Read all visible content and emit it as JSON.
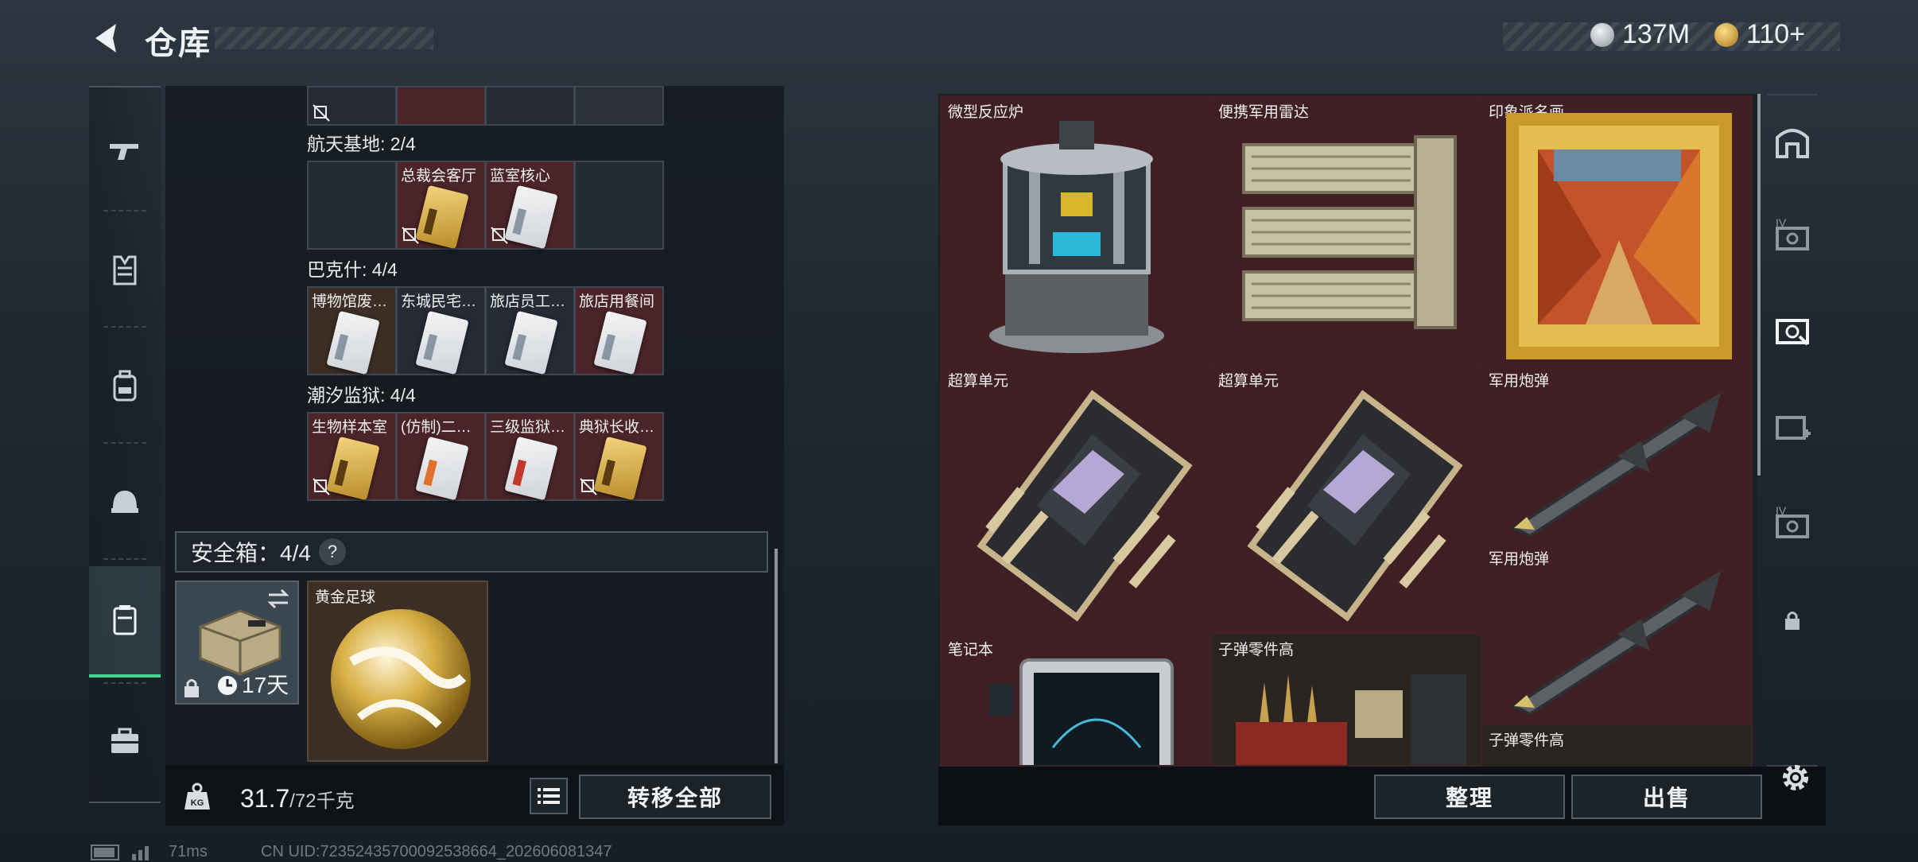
{
  "header": {
    "title": "仓库",
    "currency": [
      {
        "icon": "silver-coin-icon",
        "value": "137M",
        "color": "#c9ced3"
      },
      {
        "icon": "gold-coin-icon",
        "value": "110+",
        "color": "#d9a93a"
      }
    ]
  },
  "side_nav": {
    "items": [
      {
        "name": "nav-weapons",
        "icon": "gun-icon"
      },
      {
        "name": "nav-armor",
        "icon": "vest-icon"
      },
      {
        "name": "nav-backpack",
        "icon": "backpack-icon"
      },
      {
        "name": "nav-helmet",
        "icon": "helmet-icon"
      },
      {
        "name": "nav-case",
        "icon": "case-icon",
        "active": true
      },
      {
        "name": "nav-toolbox",
        "icon": "toolbox-icon"
      }
    ],
    "accent": "#3fd694"
  },
  "key_sections": [
    {
      "label": "航天基地: 2/4",
      "slots": [
        {
          "label": "",
          "kind": "empty"
        },
        {
          "label": "总裁会客厅",
          "kind": "red",
          "card": "gold",
          "locked": true
        },
        {
          "label": "蓝室核心",
          "kind": "red",
          "card": "white",
          "locked": true
        },
        {
          "label": "",
          "kind": "empty"
        }
      ]
    },
    {
      "label": "巴克什: 4/4",
      "slots": [
        {
          "label": "博物馆废…",
          "kind": "brown",
          "card": "white"
        },
        {
          "label": "东城民宅…",
          "kind": "dark",
          "card": "white"
        },
        {
          "label": "旅店员工…",
          "kind": "dark",
          "card": "white"
        },
        {
          "label": "旅店用餐间",
          "kind": "red",
          "card": "white"
        }
      ]
    },
    {
      "label": "潮汐监狱: 4/4",
      "slots": [
        {
          "label": "生物样本室",
          "kind": "red",
          "card": "gold",
          "locked": true
        },
        {
          "label": "(仿制)二…",
          "kind": "red",
          "card": "white-orange"
        },
        {
          "label": "三级监狱…",
          "kind": "red",
          "card": "white-red"
        },
        {
          "label": "典狱长收…",
          "kind": "red",
          "card": "gold",
          "locked": true
        }
      ]
    }
  ],
  "safe_box": {
    "label": "安全箱：4/4",
    "help": "?",
    "case_timer": "17天",
    "item_label": "黄金足球"
  },
  "capacity": {
    "weight": "31.7",
    "max": "/72千克"
  },
  "actions": {
    "transfer_all": "转移全部",
    "organize": "整理",
    "sell": "出售"
  },
  "items": [
    {
      "name": "微型反应炉"
    },
    {
      "name": "便携军用雷达"
    },
    {
      "name": "印象派名画"
    },
    {
      "name": "超算单元"
    },
    {
      "name": "超算单元"
    },
    {
      "name": "军用炮弹"
    },
    {
      "name": "军用炮弹"
    },
    {
      "name": "笔记本"
    },
    {
      "name": "子弹零件高"
    },
    {
      "name": "子弹零件高"
    }
  ],
  "right_nav": {
    "items": [
      {
        "name": "warehouse-main-icon"
      },
      {
        "name": "warehouse-iv-icon",
        "text": "IV"
      },
      {
        "name": "warehouse-active-icon"
      },
      {
        "name": "warehouse-add-icon"
      },
      {
        "name": "warehouse-iv2-icon",
        "text": "IV"
      },
      {
        "name": "lock-icon"
      }
    ]
  },
  "footer": {
    "ping": "71ms",
    "uid": "CN UID:72352435700092538664_202606081347"
  }
}
